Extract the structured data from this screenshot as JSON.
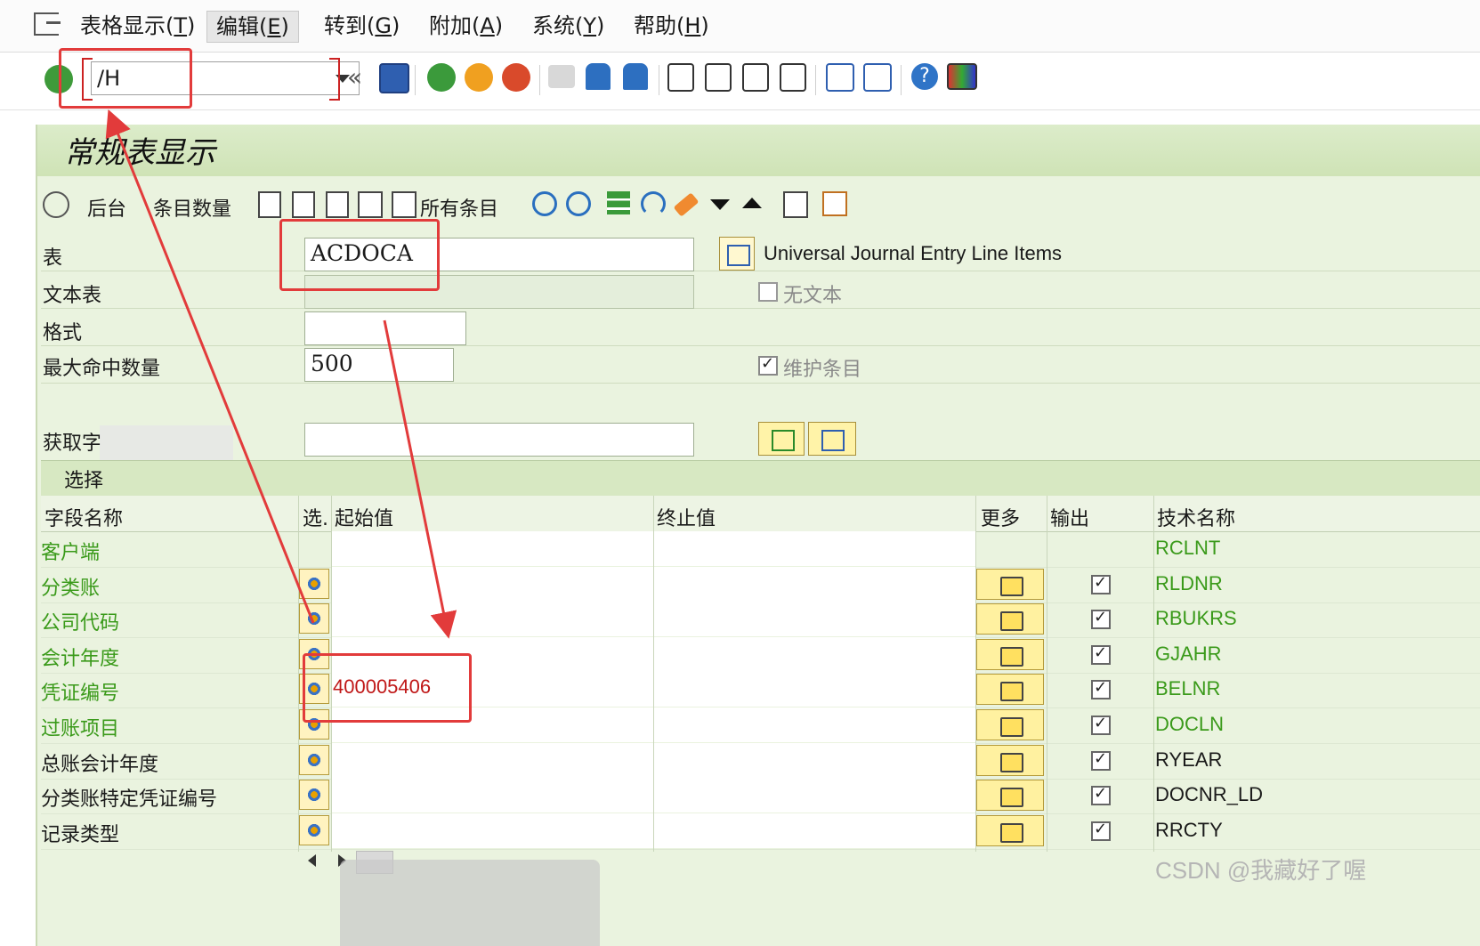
{
  "menu": {
    "items": [
      {
        "label": "表格显示(",
        "key": "T",
        "end": ")"
      },
      {
        "label": "编辑(",
        "key": "E",
        "end": ")"
      },
      {
        "label": "转到(",
        "key": "G",
        "end": ")"
      },
      {
        "label": "附加(",
        "key": "A",
        "end": ")"
      },
      {
        "label": "系统(",
        "key": "Y",
        "end": ")"
      },
      {
        "label": "帮助(",
        "key": "H",
        "end": ")"
      }
    ]
  },
  "toolbar": {
    "command_value": "/H"
  },
  "page": {
    "title": "常规表显示"
  },
  "app_toolbar": {
    "background_label": "后台",
    "entry_count_label": "条目数量",
    "all_entries_label": "所有条目"
  },
  "form": {
    "table_label": "表",
    "table_value": "ACDOCA",
    "table_description": "Universal Journal Entry Line Items",
    "text_table_label": "文本表",
    "no_text_label": "无文本",
    "format_label": "格式",
    "max_hits_label": "最大命中数量",
    "max_hits_value": "500",
    "maintain_entries_label": "维护条目",
    "fetch_label": "获取字"
  },
  "selection": {
    "section_label": "选择",
    "columns": [
      "字段名称",
      "选.",
      "起始值",
      "终止值",
      "更多",
      "输出",
      "技术名称"
    ],
    "rows": [
      {
        "name": "客户端",
        "from": "",
        "tech": "RCLNT",
        "key": true,
        "btn": false
      },
      {
        "name": "分类账",
        "from": "",
        "tech": "RLDNR",
        "key": true,
        "btn": true
      },
      {
        "name": "公司代码",
        "from": "",
        "tech": "RBUKRS",
        "key": true,
        "btn": true
      },
      {
        "name": "会计年度",
        "from": "",
        "tech": "GJAHR",
        "key": true,
        "btn": true
      },
      {
        "name": "凭证编号",
        "from": "400005406",
        "tech": "BELNR",
        "key": true,
        "btn": true
      },
      {
        "name": "过账项目",
        "from": "",
        "tech": "DOCLN",
        "key": true,
        "btn": true
      },
      {
        "name": "总账会计年度",
        "from": "",
        "tech": "RYEAR",
        "key": false,
        "btn": true
      },
      {
        "name": "分类账特定凭证编号",
        "from": "",
        "tech": "DOCNR_LD",
        "key": false,
        "btn": true
      },
      {
        "name": "记录类型",
        "from": "",
        "tech": "RRCTY",
        "key": false,
        "btn": true
      }
    ]
  },
  "watermark": "CSDN @我藏好了喔",
  "colors": {
    "key_field": "#3a9a1a",
    "highlight_value": "#c01818",
    "annotation": "#e23b3b",
    "panel_bg": "#eaf3df"
  }
}
